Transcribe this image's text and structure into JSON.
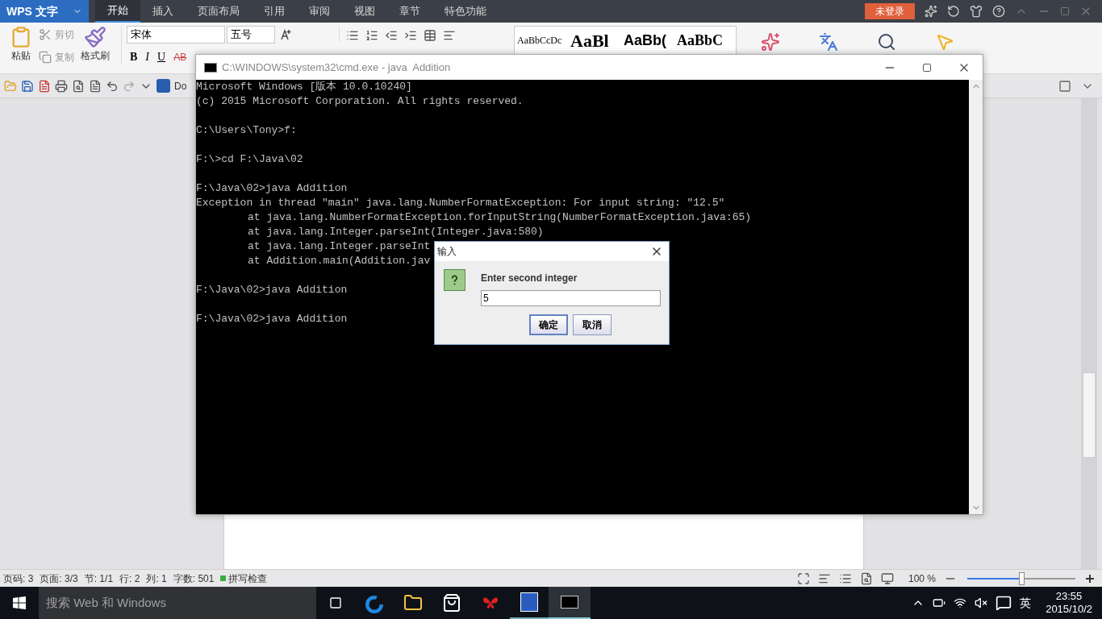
{
  "app": {
    "badge": "WPS 文字",
    "login": "未登录"
  },
  "tabs": [
    {
      "label": "开始",
      "selected": true
    },
    {
      "label": "插入",
      "selected": false
    },
    {
      "label": "页面布局",
      "selected": false
    },
    {
      "label": "引用",
      "selected": false
    },
    {
      "label": "审阅",
      "selected": false
    },
    {
      "label": "视图",
      "selected": false
    },
    {
      "label": "章节",
      "selected": false
    },
    {
      "label": "特色功能",
      "selected": false
    }
  ],
  "ribbon": {
    "paste": "粘贴",
    "cut": "剪切",
    "copy": "复制",
    "format_painter": "格式刷",
    "font": "宋体",
    "size": "五号",
    "bold": "B",
    "italic": "I",
    "underline": "U",
    "strike": "AB",
    "styles": [
      "AaBbCcDc",
      "AaBl",
      "AaBb(",
      "AaBbC"
    ]
  },
  "quick_bar": {
    "doc_tab": "Do"
  },
  "console": {
    "title": "C:\\WINDOWS\\system32\\cmd.exe - java  Addition",
    "blocks": [
      [
        {
          "text": "Microsoft Windows [版本 10.0.10240]",
          "indented": false
        },
        {
          "text": "(c) 2015 Microsoft Corporation. All rights reserved.",
          "indented": false
        }
      ],
      [
        {
          "text": "C:\\Users\\Tony>f:",
          "indented": false
        }
      ],
      [
        {
          "text": "F:\\>cd F:\\Java\\02",
          "indented": false
        }
      ],
      [
        {
          "text": "F:\\Java\\02>java Addition",
          "indented": false
        },
        {
          "text": "Exception in thread \"main\" java.lang.NumberFormatException: For input string: \"12.5\"",
          "indented": false
        },
        {
          "text": "at java.lang.NumberFormatException.forInputString(NumberFormatException.java:65)",
          "indented": true
        },
        {
          "text": "at java.lang.Integer.parseInt(Integer.java:580)",
          "indented": true
        },
        {
          "text": "at java.lang.Integer.parseInt",
          "indented": true
        },
        {
          "text": "at Addition.main(Addition.jav",
          "indented": true
        }
      ],
      [
        {
          "text": "F:\\Java\\02>java Addition",
          "indented": false
        }
      ],
      [
        {
          "text": "F:\\Java\\02>java Addition",
          "indented": false
        }
      ]
    ]
  },
  "dialog": {
    "title": "输入",
    "prompt": "Enter second integer",
    "value": "5",
    "buttons": [
      {
        "label": "确定",
        "selected": true
      },
      {
        "label": "取消",
        "selected": false
      }
    ]
  },
  "status_bar": {
    "items": [
      "页码: 3",
      "页面: 3/3",
      "节: 1/1",
      "行: 2",
      "列: 1",
      "字数: 501"
    ],
    "spell_check": "拼写检查",
    "zoom": "100 %",
    "zoom_slider": {
      "level": 0.5
    }
  },
  "taskbar": {
    "search": "搜索 Web 和 Windows",
    "ime": "英",
    "time": "23:55",
    "date": "2015/10/2"
  }
}
